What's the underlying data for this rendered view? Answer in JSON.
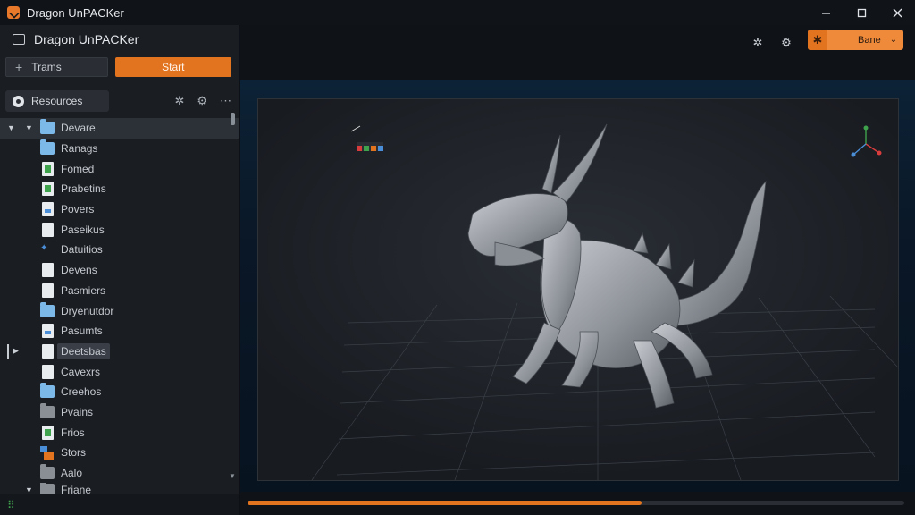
{
  "window": {
    "title": "Dragon UnPACKer",
    "controls": [
      "minimize",
      "maximize",
      "close"
    ]
  },
  "sidebar": {
    "header_title": "Dragon UnPACKer",
    "trams_label": "Trams",
    "start_label": "Start",
    "resources_label": "Resources",
    "tree": [
      {
        "label": "Devare",
        "icon": "folder",
        "expanded": true,
        "selected": true
      },
      {
        "label": "Ranags",
        "icon": "folder"
      },
      {
        "label": "Fomed",
        "icon": "doc-green"
      },
      {
        "label": "Prabetins",
        "icon": "doc-green"
      },
      {
        "label": "Povers",
        "icon": "doc-blue"
      },
      {
        "label": "Paseikus",
        "icon": "doc"
      },
      {
        "label": "Datuitios",
        "icon": "dots"
      },
      {
        "label": "Devens",
        "icon": "doc"
      },
      {
        "label": "Pasmiers",
        "icon": "doc"
      },
      {
        "label": "Dryenutdor",
        "icon": "folder"
      },
      {
        "label": "Pasumts",
        "icon": "doc-blue"
      },
      {
        "label": "Deetsbas",
        "icon": "doc",
        "highlighted": true
      },
      {
        "label": "Cavexrs",
        "icon": "doc"
      },
      {
        "label": "Creehos",
        "icon": "folder"
      },
      {
        "label": "Pvains",
        "icon": "folder-dark"
      },
      {
        "label": "Frios",
        "icon": "doc-green"
      },
      {
        "label": "Stors",
        "icon": "stack"
      },
      {
        "label": "Aalo",
        "icon": "folder-dark"
      },
      {
        "label": "Friane",
        "icon": "folder-dark"
      }
    ]
  },
  "toolbar": {
    "mode_label": "Bane"
  },
  "viewport": {
    "subject": "dragon-model"
  },
  "progress": {
    "fraction": 0.6
  },
  "colors": {
    "accent": "#e2731f",
    "panel": "#1a1d22",
    "viewport": "#1c1f24"
  }
}
